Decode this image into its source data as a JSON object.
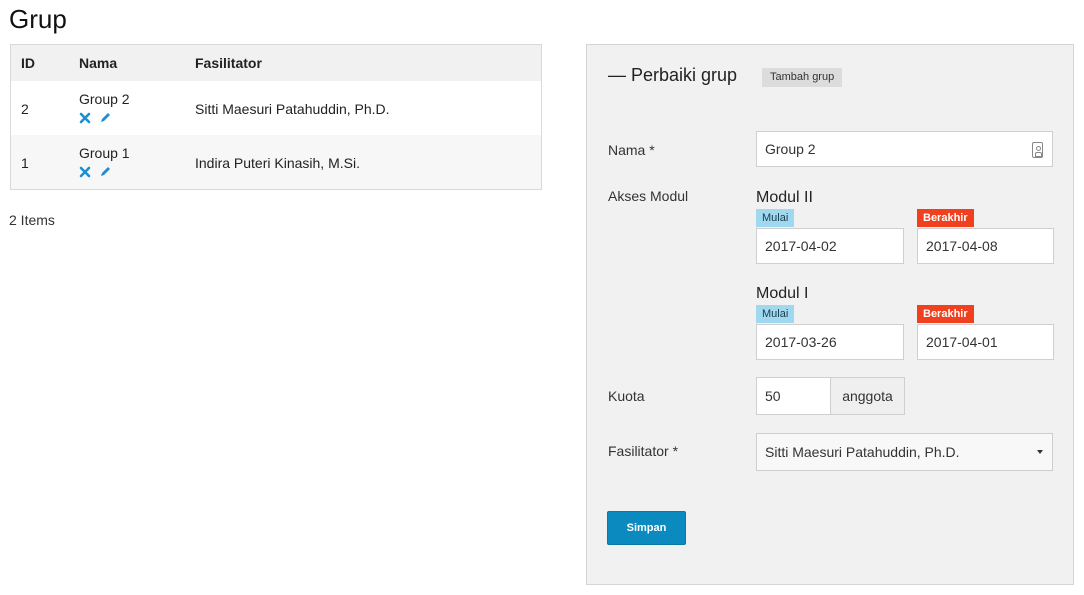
{
  "page": {
    "title": "Grup"
  },
  "table": {
    "headers": {
      "id": "ID",
      "nama": "Nama",
      "fasilitator": "Fasilitator"
    },
    "rows": [
      {
        "id": "2",
        "nama": "Group 2",
        "fasilitator": "Sitti Maesuri Patahuddin, Ph.D."
      },
      {
        "id": "1",
        "nama": "Group 1",
        "fasilitator": "Indira Puteri Kinasih, M.Si."
      }
    ],
    "count": "2 Items"
  },
  "form": {
    "legend": "— Perbaiki grup",
    "add_button": "Tambah grup",
    "nama_label": "Nama *",
    "nama_value": "Group 2",
    "akses_label": "Akses Modul",
    "modules": [
      {
        "title": "Modul II",
        "mulai_label": "Mulai",
        "berakhir_label": "Berakhir",
        "mulai": "2017-04-02",
        "berakhir": "2017-04-08"
      },
      {
        "title": "Modul I",
        "mulai_label": "Mulai",
        "berakhir_label": "Berakhir",
        "mulai": "2017-03-26",
        "berakhir": "2017-04-01"
      }
    ],
    "kuota_label": "Kuota",
    "kuota_value": "50",
    "kuota_addon": "anggota",
    "fasilitator_label": "Fasilitator *",
    "fasilitator_value": "Sitti Maesuri Patahuddin, Ph.D.",
    "save_button": "Simpan"
  },
  "colors": {
    "accent": "#0a8abf",
    "mulai_tag": "#9fd8ef",
    "berakhir_tag": "#f0401e",
    "icon_blue": "#1b8fd0"
  },
  "icons": [
    "delete-icon",
    "edit-icon",
    "contact-card-icon",
    "caret-down-icon"
  ]
}
